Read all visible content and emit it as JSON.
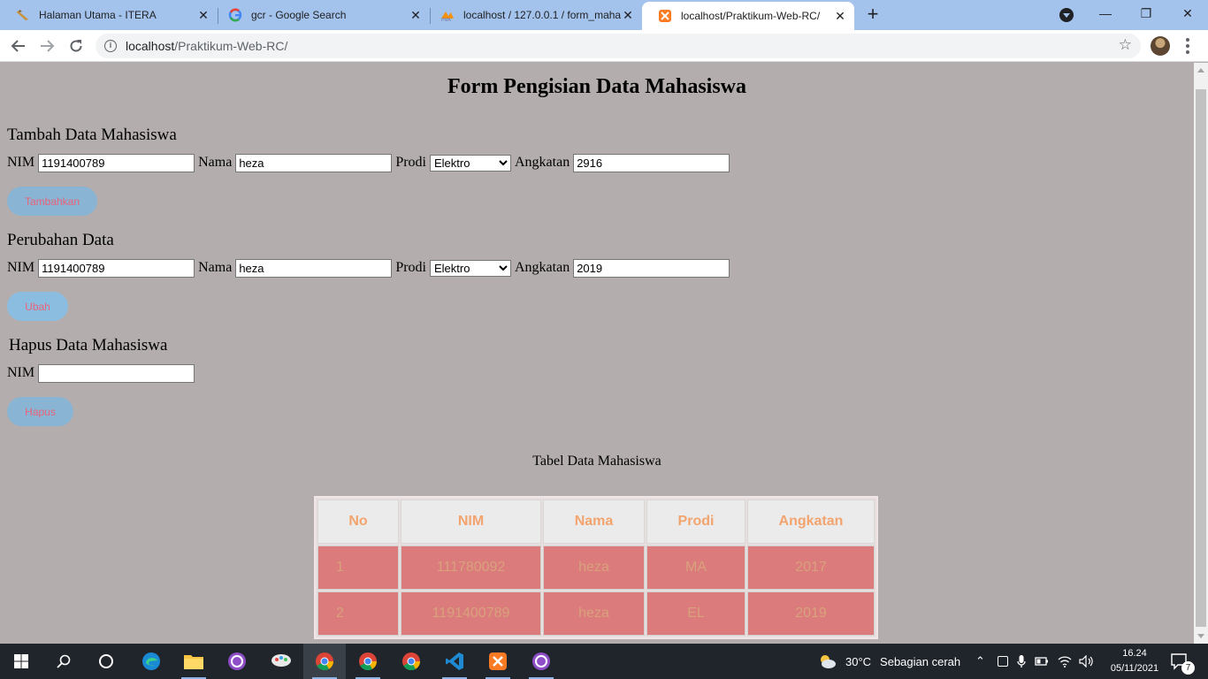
{
  "browser": {
    "tabs": [
      {
        "title": "Halaman Utama - ITERA",
        "favicon": "itera-favicon-icon",
        "active": false
      },
      {
        "title": "gcr - Google Search",
        "favicon": "google-favicon-icon",
        "active": false
      },
      {
        "title": "localhost / 127.0.0.1 / form_maha",
        "favicon": "phpmyadmin-favicon-icon",
        "active": false
      },
      {
        "title": "localhost/Praktikum-Web-RC/",
        "favicon": "xampp-favicon-icon",
        "active": true
      }
    ],
    "new_tab": "+",
    "url_host": "localhost",
    "url_path": "/Praktikum-Web-RC/",
    "window_controls": {
      "minimize": "—",
      "maximize": "❐",
      "close": "✕"
    }
  },
  "page": {
    "title": "Form Pengisian Data Mahasiswa",
    "labels": {
      "nim": "NIM",
      "nama": "Nama",
      "prodi": "Prodi",
      "angkatan": "Angkatan"
    },
    "add_section": {
      "heading": "Tambah Data Mahasiswa",
      "nim": "1191400789",
      "nama": "heza",
      "prodi": "Elektro",
      "angkatan": "2916",
      "button": "Tambahkan"
    },
    "edit_section": {
      "heading": "Perubahan Data",
      "nim": "1191400789",
      "nama": "heza",
      "prodi": "Elektro",
      "angkatan": "2019",
      "button": "Ubah"
    },
    "delete_section": {
      "heading": "Hapus Data Mahasiswa",
      "nim": "",
      "button": "Hapus"
    },
    "table": {
      "caption": "Tabel Data Mahasiswa",
      "headers": [
        "No",
        "NIM",
        "Nama",
        "Prodi",
        "Angkatan"
      ],
      "rows": [
        [
          "1",
          "111780092",
          "heza",
          "MA",
          "2017"
        ],
        [
          "2",
          "1191400789",
          "heza",
          "EL",
          "2019"
        ]
      ]
    }
  },
  "taskbar": {
    "weather_temp": "30°C",
    "weather_desc": "Sebagian cerah",
    "time": "16.24",
    "date": "05/11/2021",
    "notification_count": "7"
  },
  "colors": {
    "page_bg": "#b3adad",
    "tab_strip": "#a4c3ec",
    "button_bg": "#8bbde0",
    "button_text": "#e8637a",
    "th_text": "#f3a46e",
    "td_bg": "#db7b7b"
  }
}
